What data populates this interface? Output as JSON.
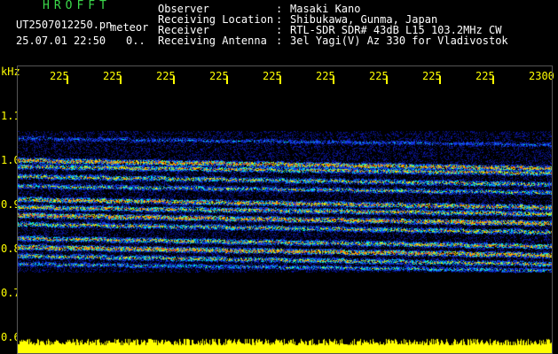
{
  "header": {
    "brand": "HROFFT",
    "file_name": "UT2507012250.pn",
    "file_type": "meteor",
    "datetime": "25.07.01 22:50",
    "status": "0.."
  },
  "metadata": [
    {
      "key": "Observer",
      "sep": ":",
      "value": "Masaki Kano"
    },
    {
      "key": "Receiving Location",
      "sep": ":",
      "value": "Shibukawa, Gunma, Japan"
    },
    {
      "key": "Receiver",
      "sep": ":",
      "value": "RTL-SDR SDR# 43dB L15 103.2MHz CW"
    },
    {
      "key": "Receiving Antenna",
      "sep": ":",
      "value": "3el Yagi(V) Az 330 for Vladivostok"
    }
  ],
  "time_axis": {
    "labels": [
      "225",
      "225",
      "225",
      "225",
      "225",
      "225",
      "225",
      "225",
      "225",
      "2300"
    ]
  },
  "freq_axis": {
    "unit": "kHz",
    "labels": [
      "1.1",
      "1.0",
      "0.9",
      "0.8",
      "0.7",
      "0.6"
    ]
  },
  "colors": {
    "background": "#000000",
    "text": "#ffffff",
    "brand": "#3bd94a",
    "axis": "#ffff00",
    "noise": "#1a2fff",
    "signal_mid": "#00e0ff",
    "signal_hi": "#ffe000",
    "signal_peak": "#ff3000"
  }
}
